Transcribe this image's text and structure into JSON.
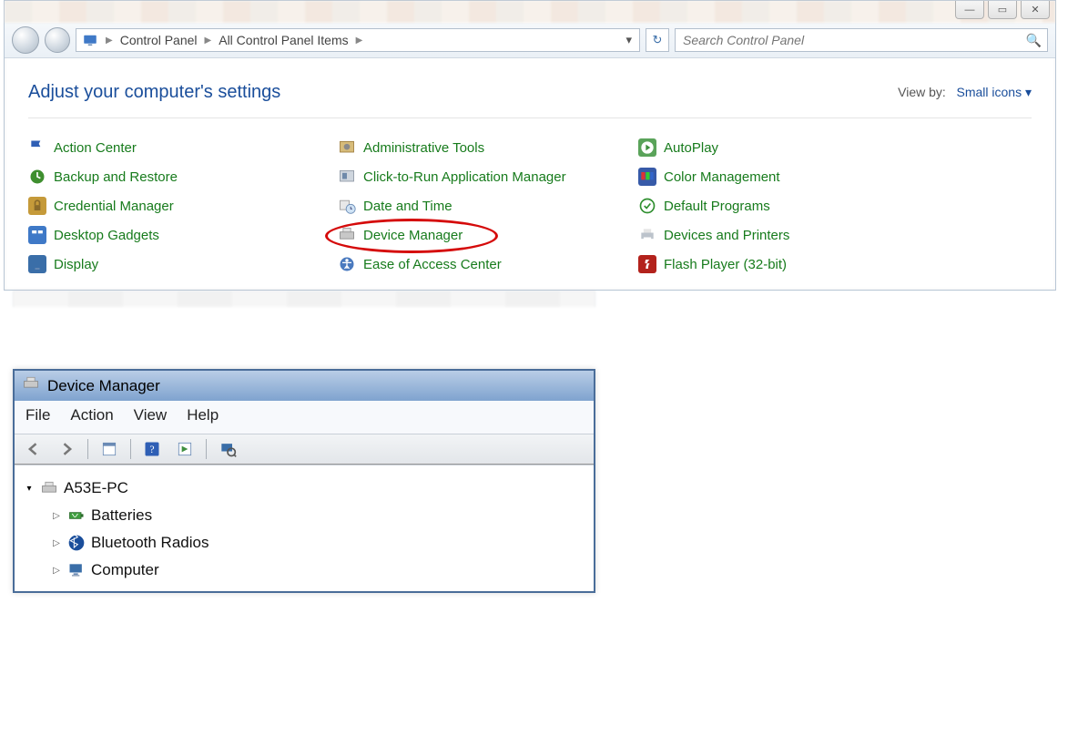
{
  "controlPanel": {
    "window": {
      "minimize": "—",
      "maximize": "▭",
      "close": "✕"
    },
    "breadcrumb": {
      "root": "Control Panel",
      "level2": "All Control Panel Items"
    },
    "search": {
      "placeholder": "Search Control Panel"
    },
    "title": "Adjust your computer's settings",
    "viewBy": {
      "label": "View by:",
      "value": "Small icons"
    },
    "items": {
      "col1": [
        {
          "label": "Action Center",
          "icon": "flag-icon"
        },
        {
          "label": "Backup and Restore",
          "icon": "backup-icon"
        },
        {
          "label": "Credential Manager",
          "icon": "credential-icon"
        },
        {
          "label": "Desktop Gadgets",
          "icon": "gadgets-icon"
        },
        {
          "label": "Display",
          "icon": "display-icon"
        }
      ],
      "col2": [
        {
          "label": "Administrative Tools",
          "icon": "admin-tools-icon"
        },
        {
          "label": "Click-to-Run Application Manager",
          "icon": "click-to-run-icon"
        },
        {
          "label": "Date and Time",
          "icon": "date-time-icon"
        },
        {
          "label": "Device Manager",
          "icon": "device-manager-icon",
          "highlighted": true
        },
        {
          "label": "Ease of Access Center",
          "icon": "ease-of-access-icon"
        }
      ],
      "col3": [
        {
          "label": "AutoPlay",
          "icon": "autoplay-icon"
        },
        {
          "label": "Color Management",
          "icon": "color-mgmt-icon"
        },
        {
          "label": "Default Programs",
          "icon": "default-programs-icon"
        },
        {
          "label": "Devices and Printers",
          "icon": "devices-printers-icon"
        },
        {
          "label": "Flash Player (32-bit)",
          "icon": "flash-player-icon"
        }
      ]
    }
  },
  "deviceManager": {
    "title": "Device Manager",
    "menu": [
      "File",
      "Action",
      "View",
      "Help"
    ],
    "rootNode": "A53E-PC",
    "children": [
      {
        "label": "Batteries",
        "icon": "battery-icon"
      },
      {
        "label": "Bluetooth Radios",
        "icon": "bluetooth-icon"
      },
      {
        "label": "Computer",
        "icon": "computer-icon"
      }
    ]
  }
}
